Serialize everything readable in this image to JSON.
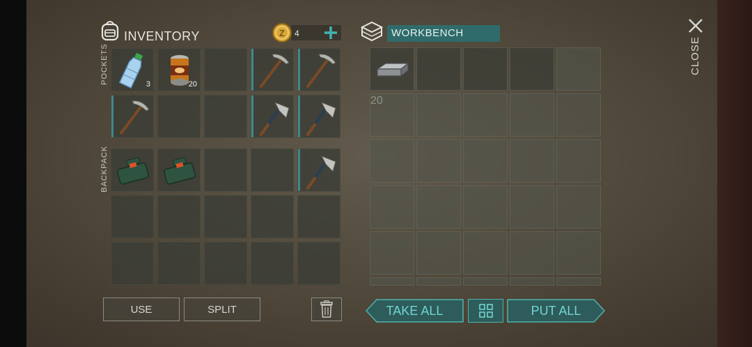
{
  "inventory": {
    "title": "INVENTORY",
    "coins": "4",
    "pockets_label": "POCKETS",
    "backpack_label": "BACKPACK",
    "items": [
      {
        "icon": "water-bottle-icon",
        "count": "3"
      },
      {
        "icon": "canned-food-icon",
        "count": "20"
      },
      {
        "icon": "pickaxe-icon",
        "count": ""
      },
      {
        "icon": "pickaxe-icon",
        "count": ""
      },
      {
        "icon": "pickaxe-icon",
        "count": ""
      },
      {
        "icon": "hatchet-icon",
        "count": ""
      },
      {
        "icon": "hatchet-icon",
        "count": ""
      },
      {
        "icon": "first-aid-kit-icon",
        "count": ""
      },
      {
        "icon": "first-aid-kit-icon",
        "count": ""
      },
      {
        "icon": "hatchet-icon",
        "count": ""
      }
    ]
  },
  "workbench": {
    "title": "WORKBENCH",
    "item": {
      "icon": "iron-bar-icon",
      "count": "20"
    }
  },
  "buttons": {
    "use": "USE",
    "split": "SPLIT",
    "take_all": "TAKE ALL",
    "put_all": "PUT ALL",
    "close": "CLOSE"
  },
  "colors": {
    "accent": "#3d8a8e",
    "teal_text": "#6fd6d3",
    "workbench_bar": "#2f6b6a"
  }
}
